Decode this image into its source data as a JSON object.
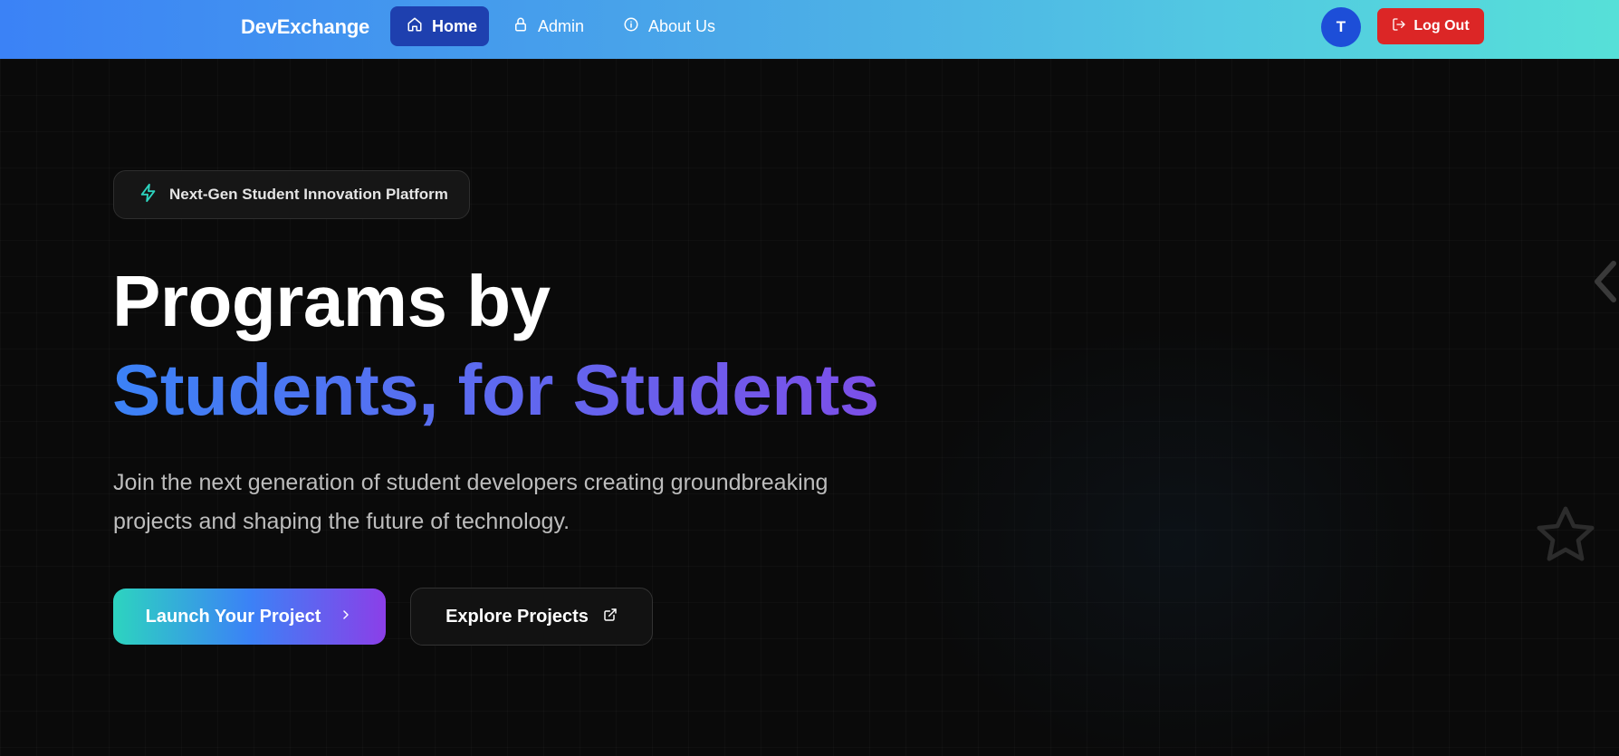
{
  "nav": {
    "brand": "DevExchange",
    "items": [
      {
        "label": "Home",
        "icon": "home-icon",
        "active": true
      },
      {
        "label": "Admin",
        "icon": "lock-icon",
        "active": false
      },
      {
        "label": "About Us",
        "icon": "info-icon",
        "active": false
      }
    ],
    "avatar_initial": "T",
    "logout_label": "Log Out"
  },
  "hero": {
    "badge_text": "Next-Gen Student Innovation Platform",
    "title_line1": "Programs by",
    "title_line2": "Students, for Students",
    "subtitle_line1": "Join the next generation of student developers creating groundbreaking",
    "subtitle_line2": "projects and shaping the future of technology.",
    "primary_button": "Launch Your Project",
    "secondary_button": "Explore Projects"
  },
  "colors": {
    "nav_gradient_start": "#3b82f6",
    "nav_gradient_end": "#56e0d8",
    "active_nav": "#1e40af",
    "logout": "#dc2626",
    "avatar": "#1d4ed8",
    "background": "#0a0a0a",
    "title_gradient_start": "#3b82f6",
    "title_gradient_end": "#7c4fe8",
    "badge_icon": "#2dd4bf"
  }
}
